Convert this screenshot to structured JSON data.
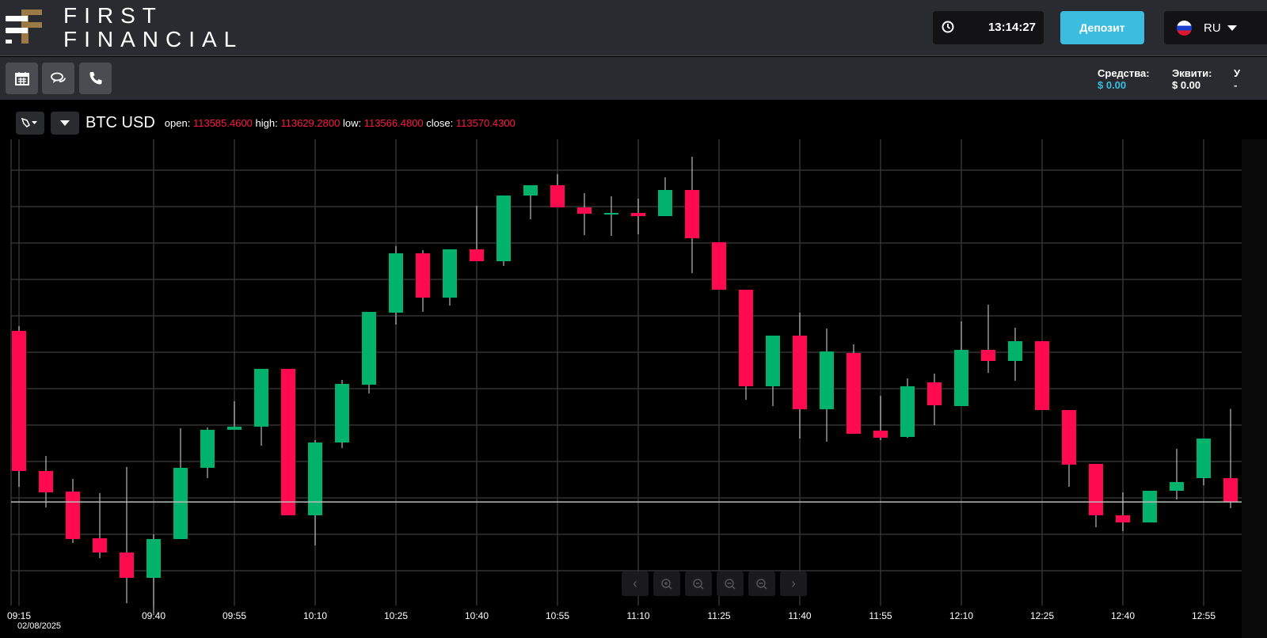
{
  "header": {
    "brand_line1": "FIRST",
    "brand_line2": "FINANCIAL",
    "clock": "13:14:27",
    "deposit_label": "Депозит",
    "language": "RU"
  },
  "toolbar": {
    "icons": [
      "calendar-icon",
      "chat-icon",
      "phone-icon"
    ]
  },
  "account": {
    "funds_label": "Средства:",
    "funds_value": "$ 0.00",
    "equity_label": "Эквити:",
    "equity_value": "$ 0.00",
    "third_label": "У",
    "third_value": "-"
  },
  "colors": {
    "up": "#00b26b",
    "down": "#ff0a50",
    "accent": "#3bbde0"
  },
  "chart_header": {
    "symbol": "BTC USD",
    "open_label": "open:",
    "open": "113585.4600",
    "high_label": "high:",
    "high": "113629.2800",
    "low_label": "low:",
    "low": "113566.4800",
    "close_label": "close:",
    "close": "113570.4300"
  },
  "chart_data": {
    "type": "candlestick",
    "title": "BTC USD",
    "date_label": "02/08/2025",
    "interval_minutes": 5,
    "x_tick_labels": [
      "09:15",
      "09:40",
      "09:55",
      "10:10",
      "10:25",
      "10:40",
      "10:55",
      "11:10",
      "11:25",
      "11:40",
      "11:55",
      "12:10",
      "12:25",
      "12:40",
      "12:55"
    ],
    "x_tick_index": [
      0,
      5,
      8,
      11,
      14,
      17,
      20,
      23,
      26,
      29,
      32,
      35,
      38,
      41,
      44
    ],
    "ylim": [
      113505,
      113799.5
    ],
    "current_price": 113570.43,
    "grid": true,
    "candles": [
      [
        113678.5,
        113681.5,
        113580,
        113590
      ],
      [
        113590,
        113599.5,
        113567,
        113576.5
      ],
      [
        113577,
        113585,
        113544.5,
        113547
      ],
      [
        113547.5,
        113576,
        113535,
        113538.5
      ],
      [
        113538.5,
        113592.5,
        113506.5,
        113522.5
      ],
      [
        113522.5,
        113550,
        113500,
        113547
      ],
      [
        113547,
        113617,
        113547,
        113592
      ],
      [
        113592,
        113617.5,
        113585.5,
        113616
      ],
      [
        113616,
        113634,
        113616,
        113618
      ],
      [
        113618,
        113654.5,
        113606,
        113654.5
      ],
      [
        113654.5,
        113654.5,
        113562,
        113562
      ],
      [
        113562,
        113609.5,
        113543,
        113608
      ],
      [
        113608,
        113647.5,
        113604.5,
        113645
      ],
      [
        113644.5,
        113690.5,
        113639,
        113690.5
      ],
      [
        113690,
        113732,
        113682.5,
        113727.5
      ],
      [
        113727.5,
        113729.5,
        113690.5,
        113699.5
      ],
      [
        113699.5,
        113730,
        113694.5,
        113730
      ],
      [
        113730,
        113757.5,
        113722.5,
        113722.5
      ],
      [
        113722.5,
        113764,
        113719.5,
        113764
      ],
      [
        113764,
        113770.5,
        113749,
        113770.5
      ],
      [
        113770.5,
        113777.5,
        113756.5,
        113756.5
      ],
      [
        113756.5,
        113765.5,
        113739,
        113752.5
      ],
      [
        113752.5,
        113763.5,
        113738.5,
        113753
      ],
      [
        113753,
        113762,
        113739.5,
        113751
      ],
      [
        113751,
        113775.5,
        113751,
        113767.5
      ],
      [
        113767.5,
        113788.5,
        113715,
        113737
      ],
      [
        113734.5,
        113734.5,
        113704.5,
        113704.5
      ],
      [
        113704.5,
        113704.5,
        113635,
        113643.5
      ],
      [
        113643.5,
        113675.5,
        113631,
        113675.5
      ],
      [
        113675.5,
        113690,
        113610.5,
        113629
      ],
      [
        113629,
        113680,
        113608.5,
        113665.5
      ],
      [
        113664.5,
        113670,
        113613.5,
        113613.5
      ],
      [
        113615.5,
        113637.5,
        113609.5,
        113611
      ],
      [
        113611.5,
        113648.5,
        113611,
        113643.5
      ],
      [
        113646,
        113651.5,
        113619,
        113631.5
      ],
      [
        113631,
        113684.5,
        113631,
        113666.5
      ],
      [
        113666.5,
        113695,
        113652,
        113659.5
      ],
      [
        113659.5,
        113680.5,
        113647,
        113672
      ],
      [
        113672,
        113672,
        113628.5,
        113628.5
      ],
      [
        113628.5,
        113628.5,
        113580,
        113594
      ],
      [
        113594.5,
        113594.5,
        113554.5,
        113562
      ],
      [
        113562,
        113576.5,
        113552,
        113557.5
      ],
      [
        113557.5,
        113577.5,
        113557.5,
        113577.5
      ],
      [
        113577.5,
        113604,
        113572,
        113583
      ],
      [
        113585.5,
        113610.5,
        113581,
        113610.5
      ],
      [
        113585.46,
        113629.28,
        113566.48,
        113570.43
      ]
    ]
  }
}
